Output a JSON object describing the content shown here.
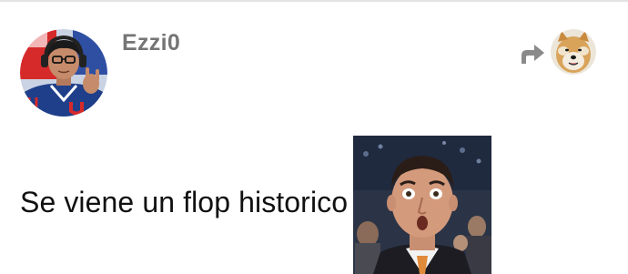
{
  "post": {
    "author": {
      "username": "Ezzi0",
      "avatar": "user-avatar"
    },
    "reply_to": {
      "icon": "reply-arrow-icon",
      "avatar": "dog-avatar"
    },
    "message": "Se viene un flop historico",
    "attachment": {
      "type": "gif",
      "description": "surprised-man-reaction-gif"
    }
  },
  "colors": {
    "divider": "#e3e3e3",
    "username": "#757575",
    "message": "#111111",
    "reply_arrow": "#8a8a8a"
  }
}
